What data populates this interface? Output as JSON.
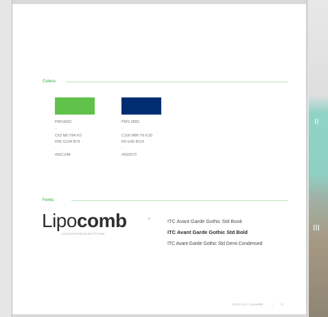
{
  "sections": {
    "colors_heading": "Colors",
    "fonts_heading": "Fonts"
  },
  "colors": [
    {
      "hex": "#60C24A",
      "pms": "PMS360C",
      "cmyk": "C63 M0 Y84 K0",
      "rgb": "R96 G194 B74",
      "code": "#60C24A"
    },
    {
      "hex": "#002D72",
      "pms": "PMS 288C",
      "cmyk": "C100 M80 Y6 K30",
      "rgb": "R0 G45 B114",
      "code": "#002D72"
    }
  ],
  "logo": {
    "light": "Lipo",
    "bold": "comb",
    "tagline": "SOCKENSTEINE/SCHÜTTSTEINE"
  },
  "fonts": {
    "book": "ITC Avant Garde Gothic Std Book",
    "bold": "ITC Avant Garde Gothic Std Bold",
    "demi": "ITC Avant Garde Gothic Std Demi Condensed"
  },
  "footer": {
    "text_prefix": "Brand book",
    "text_light": "Lipo",
    "text_bold": "comb",
    "separator": "|",
    "page": "41"
  },
  "background": {
    "tab_marks": [
      "II",
      "III"
    ]
  },
  "accent_color": "#5CC16A"
}
